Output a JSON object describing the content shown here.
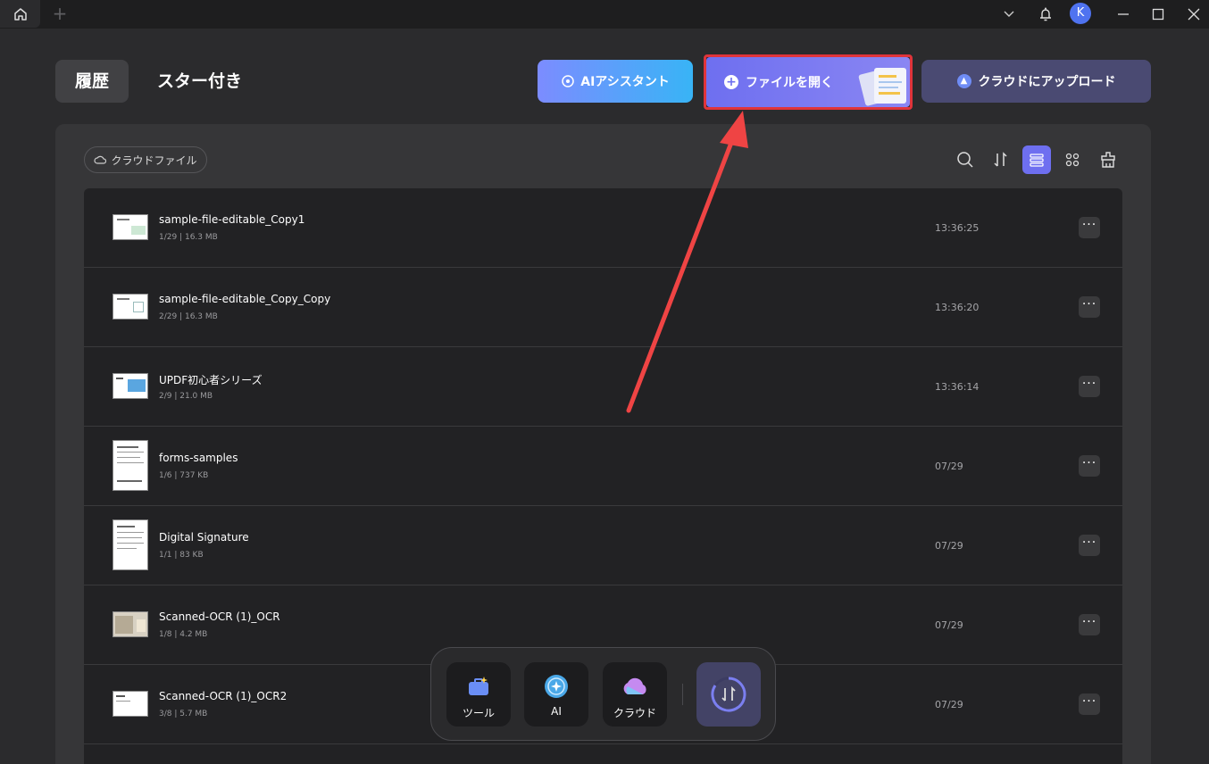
{
  "titlebar": {
    "home_icon": "home-icon",
    "add_tab": "+",
    "avatar_initial": "K"
  },
  "tabs": {
    "history": "履歴",
    "starred": "スター付き"
  },
  "actions": {
    "ai_assistant": "AIアシスタント",
    "open_file": "ファイルを開く",
    "upload_cloud": "クラウドにアップロード"
  },
  "filter": {
    "cloud_files": "クラウドファイル"
  },
  "files": [
    {
      "name": "sample-file-editable_Copy1",
      "meta": "1/29 | 16.3 MB",
      "time": "13:36:25"
    },
    {
      "name": "sample-file-editable_Copy_Copy",
      "meta": "2/29 | 16.3 MB",
      "time": "13:36:20"
    },
    {
      "name": "UPDF初心者シリーズ",
      "meta": "2/9 | 21.0 MB",
      "time": "13:36:14"
    },
    {
      "name": "forms-samples",
      "meta": "1/6 | 737 KB",
      "time": "07/29"
    },
    {
      "name": "Digital Signature",
      "meta": "1/1 | 83 KB",
      "time": "07/29"
    },
    {
      "name": "Scanned-OCR (1)_OCR",
      "meta": "1/8 | 4.2 MB",
      "time": "07/29"
    },
    {
      "name": "Scanned-OCR (1)_OCR2",
      "meta": "3/8 | 5.7 MB",
      "time": "07/29"
    }
  ],
  "more_label": "···",
  "dock": {
    "tools": "ツール",
    "ai": "AI",
    "cloud": "クラウド"
  },
  "colors": {
    "accent": "#6e6ff0",
    "highlight": "#e0343a",
    "arrow": "#ef4444"
  }
}
